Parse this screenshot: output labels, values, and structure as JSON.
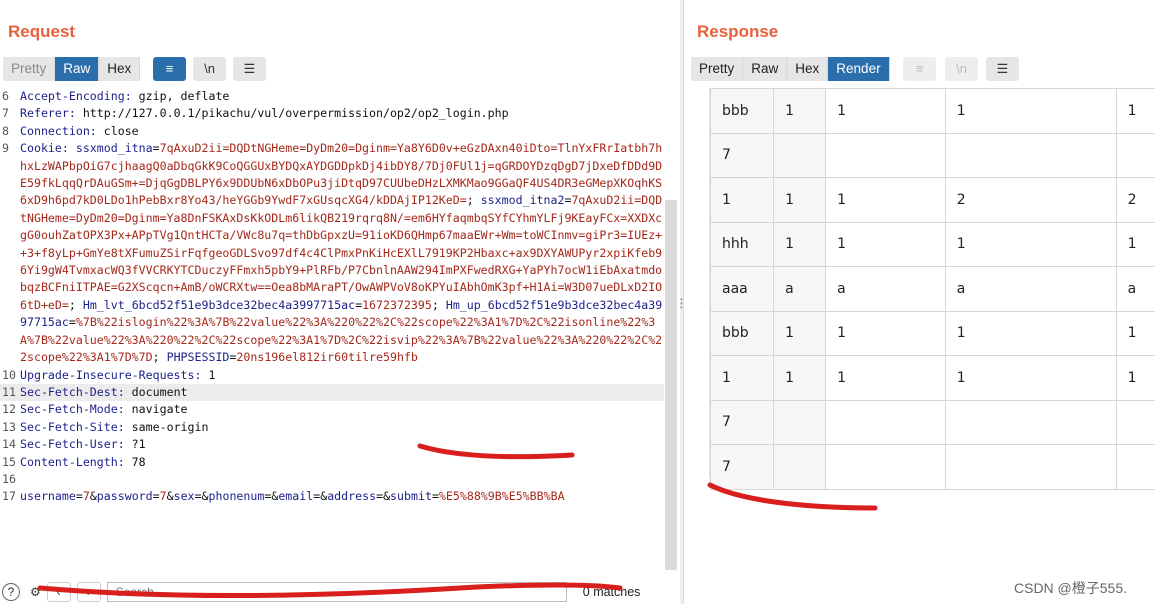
{
  "request": {
    "title": "Request",
    "tabs": [
      "Pretty",
      "Raw",
      "Hex"
    ],
    "active_tab": "Raw",
    "wrap_icon": "wrap-lines-icon",
    "newline_label": "\\n",
    "menu_icon": "hamburger-menu-icon",
    "lines": [
      {
        "n": "6",
        "key": "Accept-Encoding:",
        "val": " gzip, deflate"
      },
      {
        "n": "7",
        "key": "Referer:",
        "val": " http://127.0.0.1/pikachu/vul/overpermission/op2/op2_login.php"
      },
      {
        "n": "8",
        "key": "Connection:",
        "val": " close"
      },
      {
        "n": "9",
        "key": "Cookie:",
        "cookie": true
      },
      {
        "n": "10",
        "key": "Upgrade-Insecure-Requests:",
        "val": " 1"
      },
      {
        "n": "11",
        "key": "Sec-Fetch-Dest:",
        "val": " document",
        "hl": true
      },
      {
        "n": "12",
        "key": "Sec-Fetch-Mode:",
        "val": " navigate"
      },
      {
        "n": "13",
        "key": "Sec-Fetch-Site:",
        "val": " same-origin"
      },
      {
        "n": "14",
        "key": "Sec-Fetch-User:",
        "val": " ?1"
      },
      {
        "n": "15",
        "key": "Content-Length:",
        "val": " 78"
      },
      {
        "n": "16",
        "key": "",
        "val": ""
      },
      {
        "n": "17",
        "body": true
      }
    ],
    "cookie": [
      {
        "k": "ssxmod_itna",
        "v": "7qAxuD2ii=DQDtNGHeme=DyDm20=Dginm=Ya8Y6D0v+eGzDAxn40iDto=TlnYxFRrIatbh7hhxLzWAPbpOiG7cjhaagQ0aDbqGkK9CoQGGUxBYDQxAYDGDDpkDj4ibDY8/7Dj0FUl1j=qGRDOYDzqDgD7jDxeDfDDd9DE59fkLqqQrDAuGSm+=DjqGgDBLPY6x9DDUbN6xDbOPu3jiDtqD97CUUbeDHzLXMKMao9GGaQF4US4DR3eGMepXKOqhKS6xD9h6pd7kD0LDo1hPebBxr8Yo43/heYGGb9YwdF7xGUsqcXG4/kDDAjIP12KeD="
      },
      {
        "k": "ssxmod_itna2",
        "v": "7qAxuD2ii=DQDtNGHeme=DyDm20=Dginm=Ya8DnFSKAxDsKkODLm6likQB219rqrq8N/=em6HYfaqmbqSYfCYhmYLFj9KEayFCx=XXDXcgG0ouhZatOPX3Px+APpTVg1QntHCTa/VWc8u7q=thDbGpxzU=91ioKD6QHmp67maaEWr+Wm=toWCInmv=giPr3=IUEz++3+f8yLp+GmYe8tXFumuZSirFqfgeoGDLSvo97df4c4ClPmxPnKiHcEXlL7919KP2Hbaxc+ax9DXYAWUPyr2xpiKfeb96Yi9gW4TvmxacWQ3fVVCRKYTCDuczyFFmxh5pbY9+PlRFb/P7CbnlnAAW294ImPXFwedRXG+YaPYh7ocW1iEbAxatmdobqzBCFniITPAE=G2XScqcn+AmB/oWCRXtw==Oea8bMAraPT/OwAWPVoV8oKPYuIAbhOmK3pf+H1Ai=W3D07ueDLxD2IO6tD+eD="
      },
      {
        "k": "Hm_lvt_6bcd52f51e9b3dce32bec4a3997715ac",
        "v": "1672372395"
      },
      {
        "k": "Hm_up_6bcd52f51e9b3dce32bec4a3997715ac",
        "v": "%7B%22islogin%22%3A%7B%22value%22%3A%220%22%2C%22scope%22%3A1%7D%2C%22isonline%22%3A%7B%22value%22%3A%220%22%2C%22scope%22%3A1%7D%2C%22isvip%22%3A%7B%22value%22%3A%220%22%2C%22scope%22%3A1%7D%7D"
      },
      {
        "k": "PHPSESSID",
        "v": "20ns196el812ir60tilre59hfb"
      }
    ],
    "body_params": [
      {
        "k": "username",
        "v": "7"
      },
      {
        "k": "password",
        "v": "7"
      },
      {
        "k": "sex",
        "v": ""
      },
      {
        "k": "phonenum",
        "v": ""
      },
      {
        "k": "email",
        "v": ""
      },
      {
        "k": "address",
        "v": ""
      },
      {
        "k": "submit",
        "v": "%E5%88%9B%E5%BB%BA"
      }
    ],
    "search": {
      "placeholder": "Search...",
      "matches": "0 matches",
      "help_icon": "help-icon",
      "settings_icon": "gear-icon"
    }
  },
  "response": {
    "title": "Response",
    "tabs": [
      "Pretty",
      "Raw",
      "Hex",
      "Render"
    ],
    "active_tab": "Render",
    "newline_label": "\\n",
    "rows": [
      [
        "bbb",
        "1",
        "1",
        "1",
        "1"
      ],
      [
        "7",
        "",
        "",
        "",
        ""
      ],
      [
        "1",
        "1",
        "1",
        "2",
        "2"
      ],
      [
        "hhh",
        "1",
        "1",
        "1",
        "1"
      ],
      [
        "aaa",
        "a",
        "a",
        "a",
        "a"
      ],
      [
        "bbb",
        "1",
        "1",
        "1",
        "1"
      ],
      [
        "1",
        "1",
        "1",
        "1",
        "1"
      ],
      [
        "7",
        "",
        "",
        "",
        ""
      ],
      [
        "7",
        "",
        "",
        "",
        ""
      ]
    ]
  },
  "watermark": "CSDN @橙子555.",
  "colors": {
    "accent": "#e8613c",
    "active_tab": "#2a6fab",
    "header_key": "#1b1f8a",
    "cookie_value": "#a5281b",
    "annotation": "#d91e1e"
  }
}
